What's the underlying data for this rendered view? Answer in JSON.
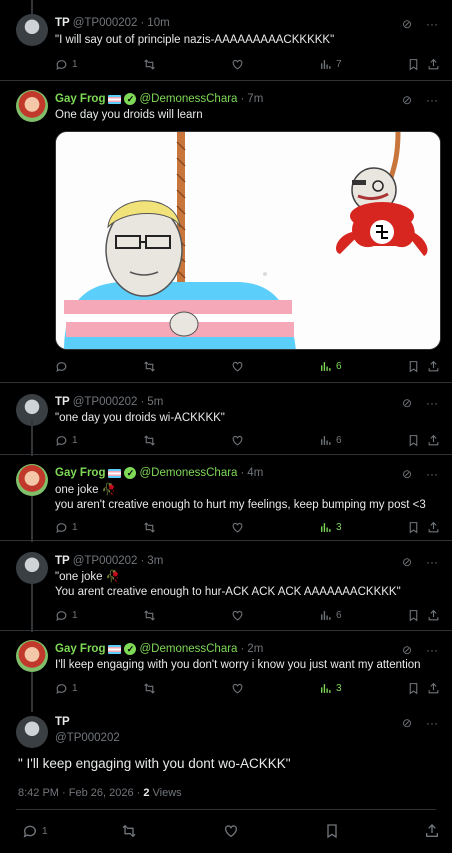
{
  "tweets": [
    {
      "name": "TP",
      "handle": "@TP000202",
      "time": "10m",
      "text": "\"I will say out of principle nazis-AAAAAAAAACKKKKK\"",
      "replies": "1",
      "views": "7"
    },
    {
      "name": "Gay Frog",
      "handle": "@DemonessChara",
      "time": "7m",
      "text": "One day you droids will learn",
      "views": "6"
    },
    {
      "name": "TP",
      "handle": "@TP000202",
      "time": "5m",
      "text": "\"one day you droids wi-ACKKKK\"",
      "replies": "1",
      "views": "6"
    },
    {
      "name": "Gay Frog",
      "handle": "@DemonessChara",
      "time": "4m",
      "text1": "one joke 🥀",
      "text2": "you aren't creative enough to hurt my feelings, keep bumping my post <3",
      "replies": "1",
      "views": "3"
    },
    {
      "name": "TP",
      "handle": "@TP000202",
      "time": "3m",
      "text1": "\"one joke 🥀",
      "text2": "You arent creative enough to hur-ACK ACK ACK AAAAAAACKKKK\"",
      "replies": "1",
      "views": "6"
    },
    {
      "name": "Gay Frog",
      "handle": "@DemonessChara",
      "time": "2m",
      "text": "I'll keep engaging with you don't worry i know you just want my attention",
      "replies": "1",
      "views": "3"
    }
  ],
  "main": {
    "name": "TP",
    "handle": "@TP000202",
    "text": "\" I'll keep engaging with you dont wo-ACKKK\"",
    "timestamp": "8:42 PM · Feb 26, 2026 · ",
    "views_count": "2",
    "views_label": " Views",
    "replies": "1"
  },
  "colors": {
    "accent_green": "#7ed957",
    "muted": "#71767b",
    "background": "#000000"
  },
  "icons": [
    "reply-icon",
    "retweet-icon",
    "like-icon",
    "views-icon",
    "bookmark-icon",
    "share-icon",
    "grok-icon",
    "more-icon"
  ]
}
